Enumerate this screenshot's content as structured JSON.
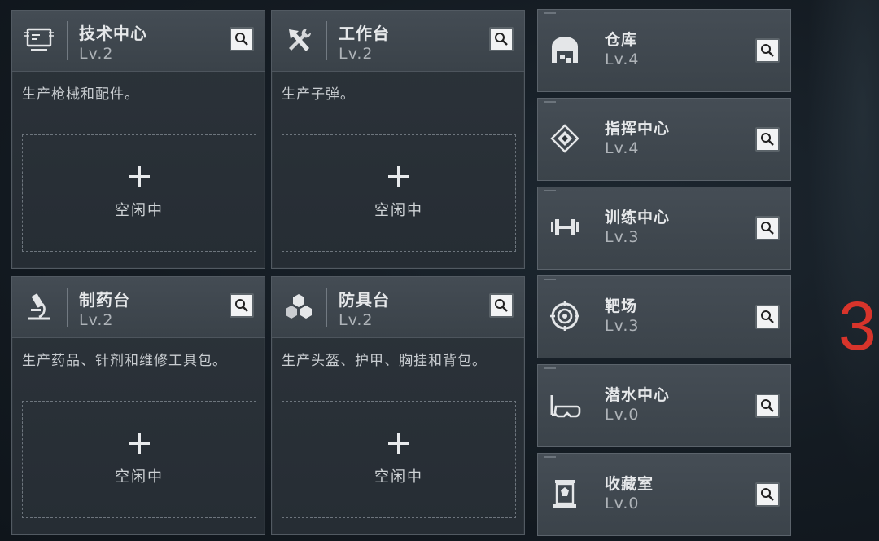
{
  "facilities_large": [
    {
      "title": "技术中心",
      "level": "Lv.2",
      "description": "生产枪械和配件。",
      "slot_label": "空闲中",
      "icon": "computer-icon"
    },
    {
      "title": "工作台",
      "level": "Lv.2",
      "description": "生产子弹。",
      "slot_label": "空闲中",
      "icon": "tools-icon"
    },
    {
      "title": "制药台",
      "level": "Lv.2",
      "description": "生产药品、针剂和维修工具包。",
      "slot_label": "空闲中",
      "icon": "microscope-icon"
    },
    {
      "title": "防具台",
      "level": "Lv.2",
      "description": "生产头盔、护甲、胸挂和背包。",
      "slot_label": "空闲中",
      "icon": "cubes-icon"
    }
  ],
  "facilities_small": [
    {
      "title": "仓库",
      "level": "Lv.4",
      "icon": "warehouse-icon"
    },
    {
      "title": "指挥中心",
      "level": "Lv.4",
      "icon": "command-chip-icon"
    },
    {
      "title": "训练中心",
      "level": "Lv.3",
      "icon": "dumbbell-icon"
    },
    {
      "title": "靶场",
      "level": "Lv.3",
      "icon": "target-icon"
    },
    {
      "title": "潜水中心",
      "level": "Lv.0",
      "icon": "diving-mask-icon"
    },
    {
      "title": "收藏室",
      "level": "Lv.0",
      "icon": "trophy-case-icon"
    }
  ],
  "side_number": "3",
  "colors": {
    "accent_red": "#d8342b",
    "panel": "#2c333a",
    "header": "#3f474e"
  }
}
